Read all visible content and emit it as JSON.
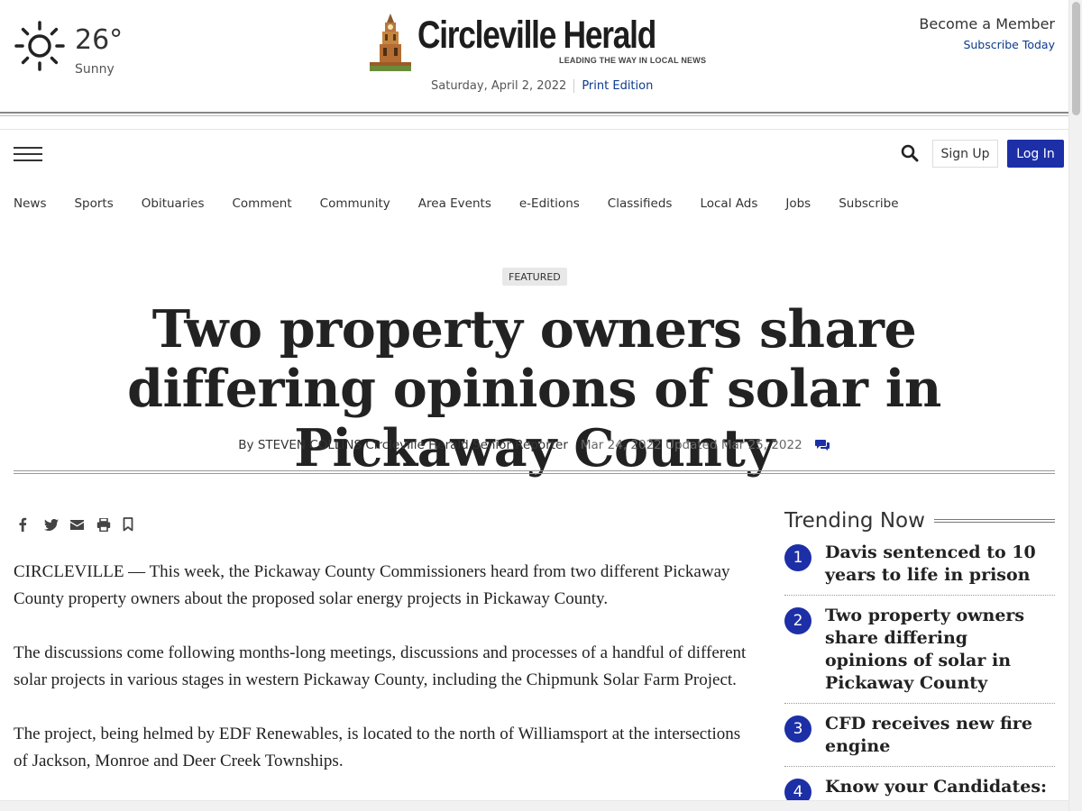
{
  "weather": {
    "temperature": "26°",
    "condition": "Sunny",
    "icon": "sun-icon"
  },
  "masthead": {
    "title": "Circleville Herald",
    "tagline": "LEADING THE WAY IN LOCAL NEWS",
    "date": "Saturday, April 2, 2022",
    "print_edition": "Print Edition"
  },
  "account": {
    "become_member": "Become a Member",
    "subscribe_today": "Subscribe Today",
    "sign_up": "Sign Up",
    "log_in": "Log In"
  },
  "nav": {
    "items": [
      "News",
      "Sports",
      "Obituaries",
      "Comment",
      "Community",
      "Area Events",
      "e-Editions",
      "Classifieds",
      "Local Ads",
      "Jobs",
      "Subscribe"
    ]
  },
  "article": {
    "badge": "FEATURED",
    "headline": "Two property owners share differing opinions of solar in Pickaway County",
    "byline": "By STEVEN COLLINS Circleville Herald Senior Reporter",
    "dates": "Mar 24, 2022 Updated Mar 25, 2022",
    "paragraphs": [
      "CIRCLEVILLE — This week, the Pickaway County Commissioners heard from two different Pickaway County property owners about the proposed solar energy projects in Pickaway County.",
      "The discussions come following months-long meetings, discussions and processes of a handful of different solar projects in various stages in western Pickaway County, including the Chipmunk Solar Farm Project.",
      "The project, being helmed by EDF Renewables, is located to the north of Williamsport at the intersections of Jackson, Monroe and Deer Creek Townships."
    ]
  },
  "share_icons": [
    "facebook-icon",
    "twitter-icon",
    "email-icon",
    "print-icon",
    "bookmark-icon"
  ],
  "trending": {
    "title": "Trending Now",
    "items": [
      {
        "num": "1",
        "text": "Davis sentenced to 10 years to life in prison"
      },
      {
        "num": "2",
        "text": "Two property owners share differing opinions of solar in Pickaway County"
      },
      {
        "num": "3",
        "text": "CFD receives new fire engine"
      },
      {
        "num": "4",
        "text": "Know your Candidates: Republican Primary for"
      }
    ]
  },
  "colors": {
    "accent": "#1d2fa6",
    "link": "#0b3a8c"
  }
}
